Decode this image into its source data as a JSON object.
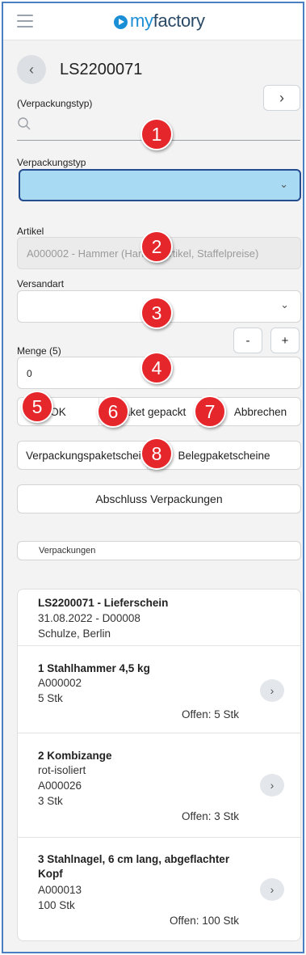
{
  "header": {
    "menu_icon": "hamburger-icon",
    "logo_text_left": "my",
    "logo_text_right": "factory"
  },
  "page": {
    "title": "LS2200071",
    "back_icon": "chevron-left-icon",
    "next_icon": "chevron-right-icon"
  },
  "search": {
    "label": "(Verpackungstyp)",
    "value": "",
    "placeholder": ""
  },
  "packaging_type": {
    "label": "Verpackungstyp",
    "value": ""
  },
  "article": {
    "label": "Artikel",
    "value": "A000002 - Hammer (Handelsartikel, Staffelpreise)"
  },
  "shipping": {
    "label": "Versandart",
    "value": ""
  },
  "quantity": {
    "label": "Menge (5)",
    "value": "0",
    "minus_label": "-",
    "plus_label": "+"
  },
  "actions": {
    "ok_label": "OK",
    "packed_label": "Paket gepackt",
    "cancel_label": "Abbrechen"
  },
  "slips": {
    "packaging_label": "Verpackungspaketscheine",
    "document_label": "Belegpaketscheine"
  },
  "finish_label": "Abschluss Verpackungen",
  "section_label": "Verpackungen",
  "document": {
    "title": "LS2200071 - Lieferschein",
    "date_line": "31.08.2022 - D00008",
    "customer": "Schulze, Berlin"
  },
  "items": [
    {
      "title": "1 Stahlhammer 4,5 kg",
      "lines": [
        "A000002",
        "5 Stk"
      ],
      "open": "Offen: 5 Stk"
    },
    {
      "title": "2 Kombizange",
      "lines": [
        "rot-isoliert",
        "A000026",
        "3 Stk"
      ],
      "open": "Offen: 3 Stk"
    },
    {
      "title": "3 Stahlnagel, 6 cm lang, abgeflachter Kopf",
      "lines": [
        "A000013",
        "100 Stk"
      ],
      "open": "Offen: 100 Stk"
    }
  ],
  "markers": [
    "1",
    "2",
    "3",
    "4",
    "5",
    "6",
    "7",
    "8"
  ],
  "colors": {
    "accent": "#1b8fd6",
    "selected_field": "#a8dbf3",
    "marker": "#e5262b",
    "frame": "#4a7fc1"
  }
}
